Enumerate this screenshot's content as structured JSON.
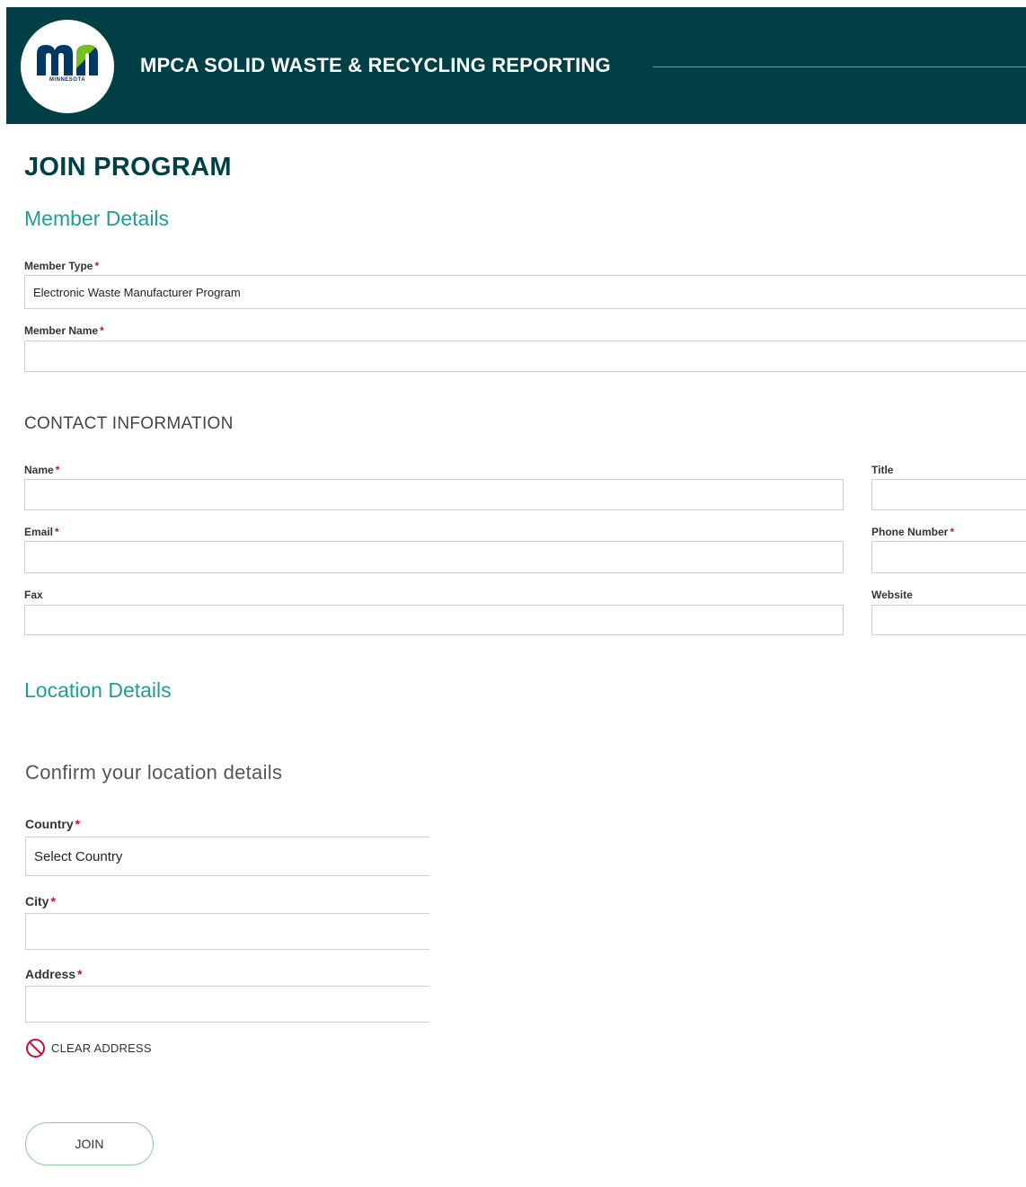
{
  "header": {
    "logo_text": "mn",
    "logo_state": "MINNESOTA",
    "title": "MPCA SOLID WASTE & RECYCLING REPORTING"
  },
  "page": {
    "title": "JOIN PROGRAM"
  },
  "member_details": {
    "heading": "Member Details",
    "member_type": {
      "label": "Member Type",
      "required": "*",
      "value": "Electronic Waste Manufacturer Program"
    },
    "member_name": {
      "label": "Member Name",
      "required": "*",
      "value": ""
    }
  },
  "contact": {
    "heading": "CONTACT INFORMATION",
    "name": {
      "label": "Name",
      "required": "*",
      "value": ""
    },
    "title": {
      "label": "Title",
      "value": ""
    },
    "email": {
      "label": "Email",
      "required": "*",
      "value": ""
    },
    "phone": {
      "label": "Phone Number",
      "required": "*",
      "value": ""
    },
    "fax": {
      "label": "Fax",
      "value": ""
    },
    "website": {
      "label": "Website",
      "value": ""
    }
  },
  "location": {
    "heading": "Location Details",
    "subheading": "Confirm your location details",
    "country": {
      "label": "Country",
      "required": "*",
      "value": "Select Country"
    },
    "city": {
      "label": "City",
      "required": "*",
      "value": ""
    },
    "address": {
      "label": "Address",
      "required": "*",
      "value": ""
    },
    "clear_label": "CLEAR ADDRESS"
  },
  "actions": {
    "join_label": "JOIN"
  },
  "colors": {
    "header_bg": "#003f45",
    "accent_teal": "#1f9d96",
    "required": "#c8102e",
    "logo_blue": "#003865",
    "logo_green": "#78be20"
  },
  "icons": {
    "clear_address": "no-entry-icon"
  }
}
